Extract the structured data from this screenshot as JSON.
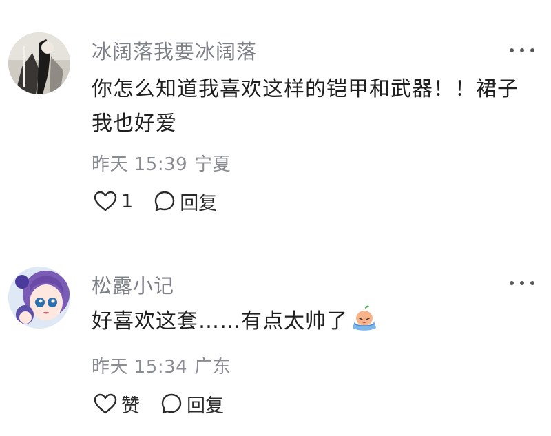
{
  "comments": [
    {
      "username": "冰阔落我要冰阔落",
      "text": "你怎么知道我喜欢这样的铠甲和武器！！裙子我也好爱",
      "time": "昨天 15:39",
      "location": "宁夏",
      "like_label": "1",
      "reply_label": "回复",
      "avatar_icon": "avatar-grayscale-photo",
      "colors": {
        "username": "#7e8088",
        "meta": "#8a8c93"
      }
    },
    {
      "username": "松露小记",
      "text": "好喜欢这套……有点太帅了",
      "emoji": "laughing-crying-emoji",
      "time": "昨天 15:34",
      "location": "广东",
      "like_label": "赞",
      "reply_label": "回复",
      "avatar_icon": "avatar-anime-purple-hair"
    }
  ]
}
